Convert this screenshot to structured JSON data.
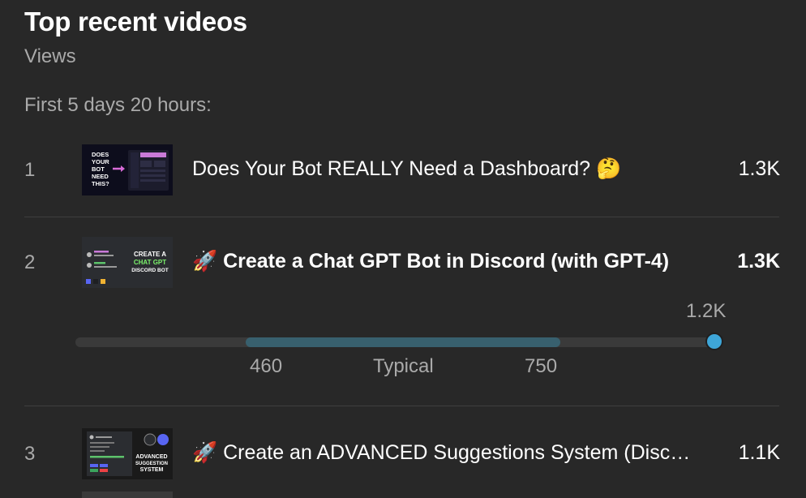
{
  "header": {
    "title": "Top recent videos",
    "subtitle": "Views",
    "period": "First 5 days 20 hours:"
  },
  "videos": [
    {
      "rank": "1",
      "title": "Does Your Bot REALLY Need a Dashboard? 🤔",
      "views": "1.3K",
      "thumb_text": [
        "DOES",
        "YOUR",
        "BOT",
        "NEED",
        "THIS?"
      ]
    },
    {
      "rank": "2",
      "title": "🚀 Create a Chat GPT Bot in Discord (with GPT-4)",
      "views": "1.3K",
      "thumb_text": [
        "CREATE A",
        "CHAT GPT",
        "DISCORD BOT"
      ]
    },
    {
      "rank": "3",
      "title": "🚀 Create an ADVANCED Suggestions System (Disco…",
      "views": "1.1K",
      "thumb_text": [
        "ADVANCED",
        "SUGGESTION",
        "SYSTEM"
      ]
    }
  ],
  "range": {
    "max_label": "1.2K",
    "low_label": "460",
    "typical_label": "Typical",
    "high_label": "750",
    "colors": {
      "track": "#3a3a3a",
      "typical": "#38606e",
      "marker": "#3ea6d8"
    }
  }
}
